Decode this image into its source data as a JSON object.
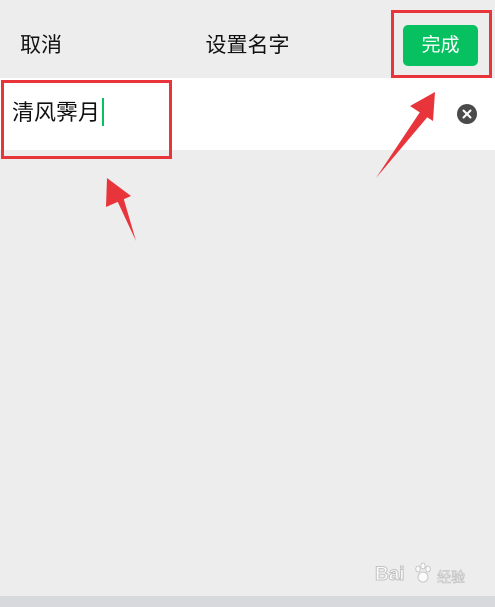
{
  "header": {
    "cancel_label": "取消",
    "title": "设置名字",
    "done_label": "完成"
  },
  "name_field": {
    "value": "清风霁月"
  },
  "watermark": {
    "brand_left": "Bai",
    "brand_right": "经验"
  },
  "colors": {
    "background": "#ededed",
    "accent_green": "#07c160",
    "annotation_red": "#e8343b"
  },
  "icons": {
    "clear": "clear-input-icon"
  }
}
